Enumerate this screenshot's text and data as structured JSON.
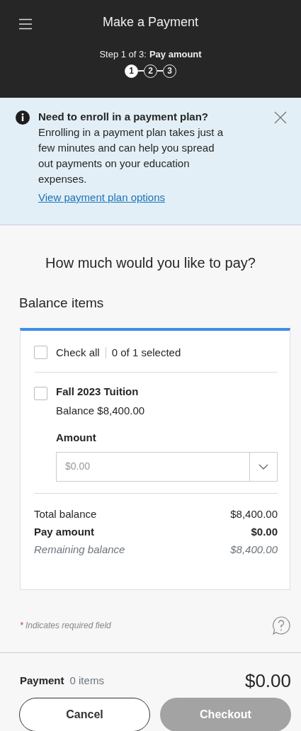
{
  "header": {
    "title": "Make a Payment",
    "step_text": "Step 1 of 3:",
    "step_name": "Pay amount",
    "steps": [
      {
        "label": "1",
        "selected": true
      },
      {
        "label": "2",
        "selected": false
      },
      {
        "label": "3",
        "selected": false
      }
    ]
  },
  "alert": {
    "title": "Need to enroll in a payment plan?",
    "body": "Enrolling in a payment plan takes just a few minutes and can help you spread out payments on your education expenses.",
    "link": "View payment plan options"
  },
  "question": "How much would you like to pay?",
  "section_title": "Balance items",
  "check_all": {
    "label": "Check all",
    "count": "0 of 1 selected",
    "checked": false
  },
  "items": [
    {
      "name": "Fall 2023 Tuition",
      "balance": "Balance $8,400.00",
      "checked": false,
      "amount_label": "Amount",
      "amount_placeholder": "$0.00"
    }
  ],
  "totals": [
    {
      "kind": "normal",
      "label": "Total balance",
      "value": "$8,400.00"
    },
    {
      "kind": "bold",
      "label": "Pay amount",
      "value": "$0.00"
    },
    {
      "kind": "italic",
      "label": "Remaining balance",
      "value": "$8,400.00"
    }
  ],
  "required_note": {
    "mark": "*",
    "text": "Indicates required field"
  },
  "footer": {
    "label": "Payment",
    "count": "0 items",
    "total": "$0.00",
    "cancel": "Cancel",
    "checkout": "Checkout",
    "checkout_disabled": true
  }
}
